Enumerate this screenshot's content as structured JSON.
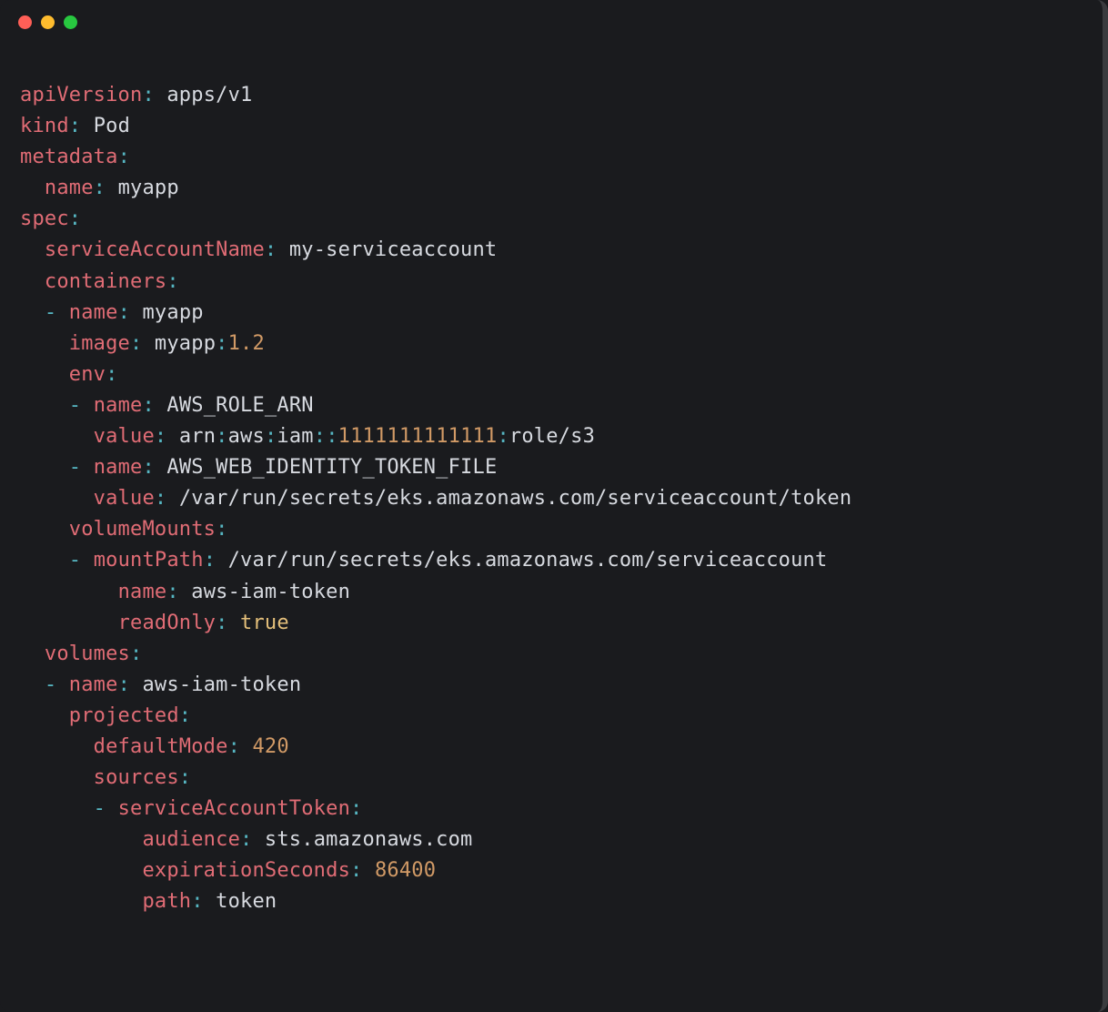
{
  "yaml": {
    "apiVersion": "apps/v1",
    "kind": "Pod",
    "metadata": {
      "name": "myapp"
    },
    "spec": {
      "serviceAccountName": "my-serviceaccount",
      "containers": [
        {
          "name": "myapp",
          "image_name": "myapp",
          "image_tag": "1.2",
          "env": [
            {
              "name": "AWS_ROLE_ARN",
              "value_prefix": "arn",
              "value_parts": [
                "aws",
                "iam",
                "",
                "1111111111111",
                "role/s3"
              ]
            },
            {
              "name": "AWS_WEB_IDENTITY_TOKEN_FILE",
              "value": "/var/run/secrets/eks.amazonaws.com/serviceaccount/token"
            }
          ],
          "volumeMounts": [
            {
              "mountPath": "/var/run/secrets/eks.amazonaws.com/serviceaccount",
              "name": "aws-iam-token",
              "readOnly": "true"
            }
          ]
        }
      ],
      "volumes": [
        {
          "name": "aws-iam-token",
          "projected": {
            "defaultMode": "420",
            "sources": [
              {
                "serviceAccountToken": {
                  "audience": "sts.amazonaws.com",
                  "expirationSeconds": "86400",
                  "path": "token"
                }
              }
            ]
          }
        }
      ]
    }
  },
  "keys": {
    "apiVersion": "apiVersion",
    "kind": "kind",
    "metadata": "metadata",
    "name": "name",
    "spec": "spec",
    "serviceAccountName": "serviceAccountName",
    "containers": "containers",
    "image": "image",
    "env": "env",
    "value": "value",
    "volumeMounts": "volumeMounts",
    "mountPath": "mountPath",
    "readOnly": "readOnly",
    "volumes": "volumes",
    "projected": "projected",
    "defaultMode": "defaultMode",
    "sources": "sources",
    "serviceAccountToken": "serviceAccountToken",
    "audience": "audience",
    "expirationSeconds": "expirationSeconds",
    "path": "path"
  }
}
